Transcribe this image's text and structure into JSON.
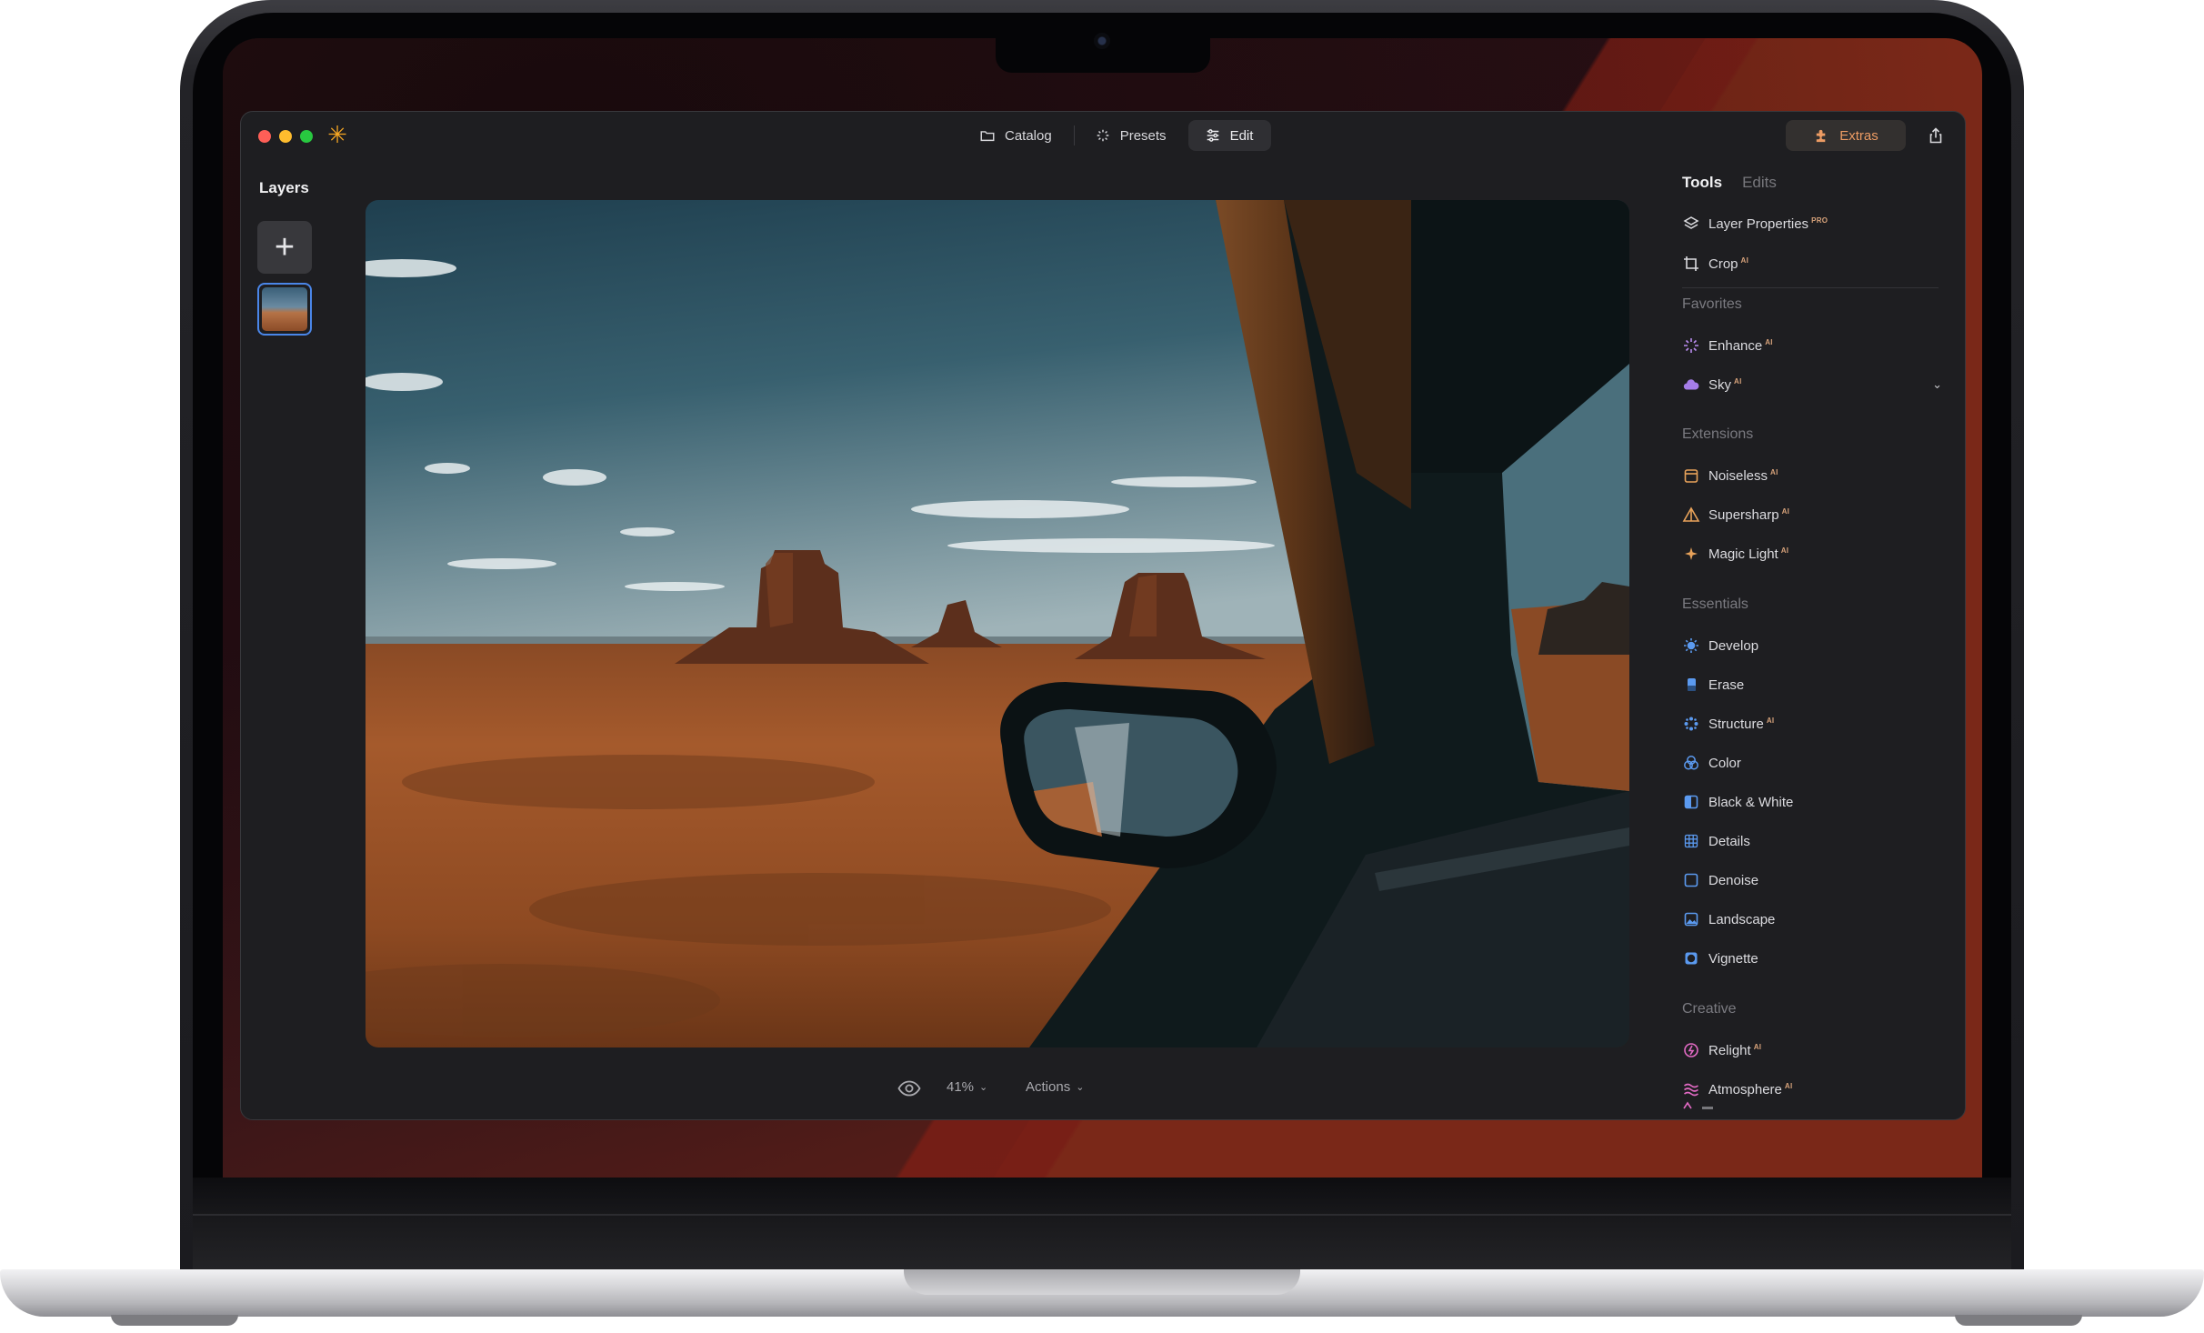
{
  "window": {
    "tabs": [
      {
        "label": "Catalog",
        "icon": "folder-icon",
        "active": false
      },
      {
        "label": "Presets",
        "icon": "sparkle-icon",
        "active": false
      },
      {
        "label": "Edit",
        "icon": "sliders-icon",
        "active": true
      }
    ],
    "extras_label": "Extras",
    "accent_color": "#ec9b63"
  },
  "layers": {
    "title": "Layers"
  },
  "bottombar": {
    "zoom": "41%",
    "actions_label": "Actions"
  },
  "tools": {
    "tabs": [
      {
        "label": "Tools",
        "active": true
      },
      {
        "label": "Edits",
        "active": false
      }
    ],
    "top_items": [
      {
        "label": "Layer Properties",
        "badge": "PRO",
        "icon": "layers-icon"
      },
      {
        "label": "Crop",
        "badge": "AI",
        "icon": "crop-icon"
      }
    ],
    "sections": {
      "favorites": "Favorites",
      "extensions": "Extensions",
      "essentials": "Essentials",
      "creative": "Creative"
    },
    "favorites": [
      {
        "label": "Enhance",
        "badge": "AI",
        "icon": "enhance-icon"
      },
      {
        "label": "Sky",
        "badge": "AI",
        "icon": "cloud-icon"
      }
    ],
    "extensions": [
      {
        "label": "Noiseless",
        "badge": "AI",
        "icon": "noiseless-icon"
      },
      {
        "label": "Supersharp",
        "badge": "AI",
        "icon": "supersharp-icon"
      },
      {
        "label": "Magic Light",
        "badge": "AI",
        "icon": "magic-light-icon"
      }
    ],
    "essentials": [
      {
        "label": "Develop",
        "icon": "sun-icon"
      },
      {
        "label": "Erase",
        "icon": "eraser-icon"
      },
      {
        "label": "Structure",
        "badge": "AI",
        "icon": "structure-icon"
      },
      {
        "label": "Color",
        "icon": "color-circles-icon"
      },
      {
        "label": "Black & White",
        "icon": "black-white-icon"
      },
      {
        "label": "Details",
        "icon": "details-grid-icon"
      },
      {
        "label": "Denoise",
        "icon": "denoise-icon"
      },
      {
        "label": "Landscape",
        "icon": "landscape-icon"
      },
      {
        "label": "Vignette",
        "icon": "vignette-icon"
      }
    ],
    "creative": [
      {
        "label": "Relight",
        "badge": "AI",
        "icon": "relight-icon"
      },
      {
        "label": "Atmosphere",
        "badge": "AI",
        "icon": "atmosphere-icon"
      }
    ]
  }
}
